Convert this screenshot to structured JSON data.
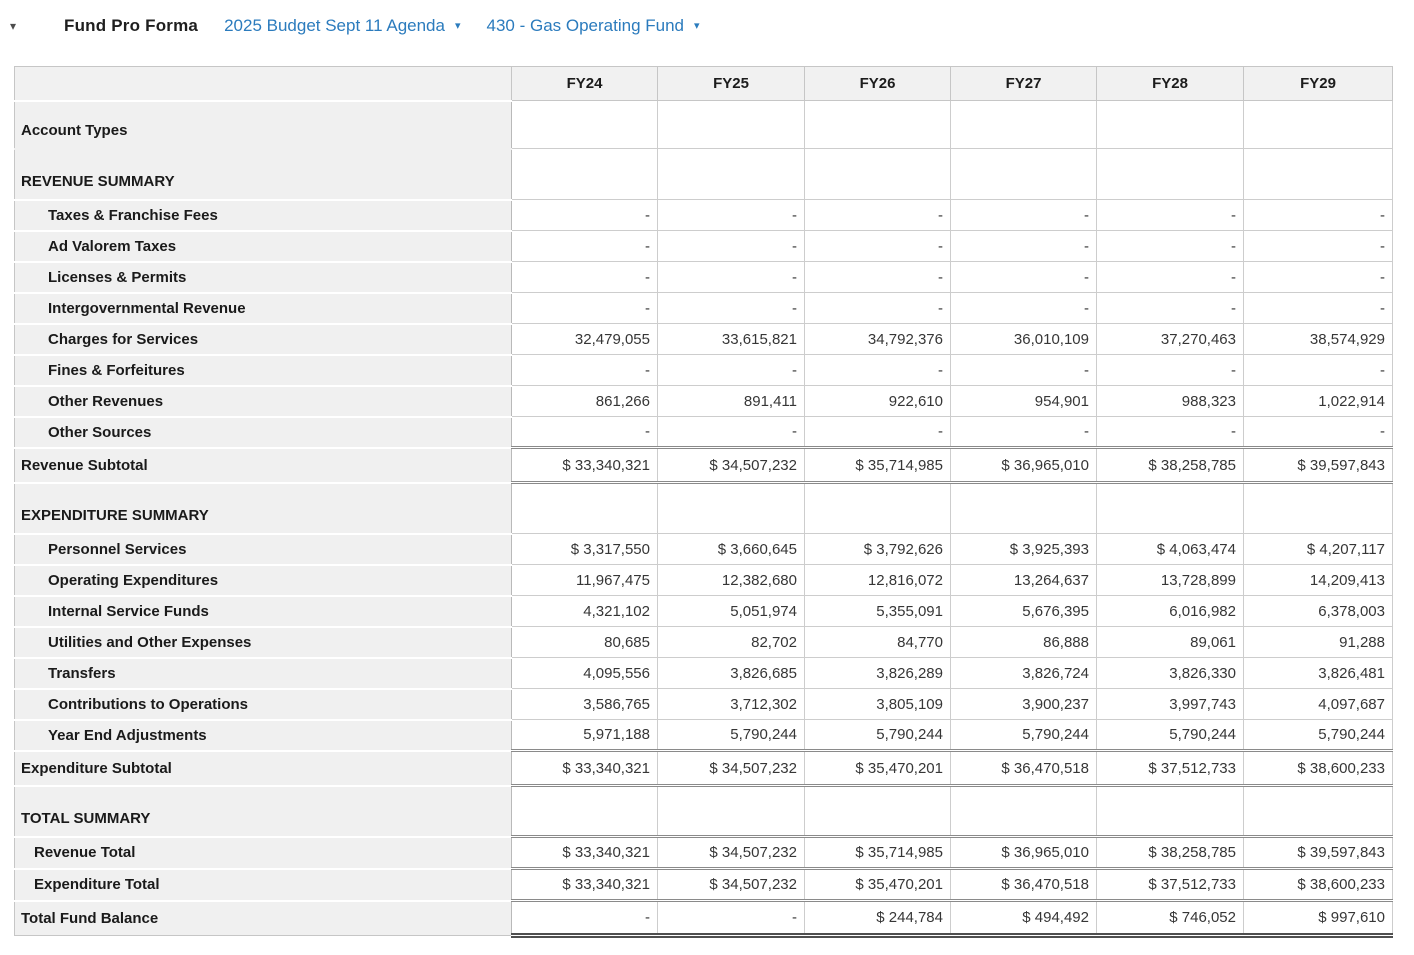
{
  "header": {
    "collapse_caret": "▾",
    "title": "Fund Pro Forma",
    "dropdowns": [
      {
        "label": "2025 Budget Sept 11 Agenda",
        "caret": "▾"
      },
      {
        "label": "430 - Gas Operating Fund",
        "caret": "▾"
      }
    ]
  },
  "colors": {
    "link_blue": "#2b7bbd",
    "label_column_bg": "#f0f0f0",
    "grid_border": "#cdcdcd"
  },
  "table": {
    "columns": [
      "FY24",
      "FY25",
      "FY26",
      "FY27",
      "FY28",
      "FY29"
    ],
    "rows": [
      {
        "label": "Account Types",
        "style": "section-intro",
        "values": [
          "",
          "",
          "",
          "",
          "",
          ""
        ]
      },
      {
        "label": "REVENUE SUMMARY",
        "style": "section",
        "values": [
          "",
          "",
          "",
          "",
          "",
          ""
        ]
      },
      {
        "label": "Taxes & Franchise Fees",
        "style": "detail",
        "values": [
          "-",
          "-",
          "-",
          "-",
          "-",
          "-"
        ]
      },
      {
        "label": "Ad Valorem Taxes",
        "style": "detail",
        "values": [
          "-",
          "-",
          "-",
          "-",
          "-",
          "-"
        ]
      },
      {
        "label": "Licenses & Permits",
        "style": "detail",
        "values": [
          "-",
          "-",
          "-",
          "-",
          "-",
          "-"
        ]
      },
      {
        "label": "Intergovernmental Revenue",
        "style": "detail",
        "values": [
          "-",
          "-",
          "-",
          "-",
          "-",
          "-"
        ]
      },
      {
        "label": "Charges for Services",
        "style": "detail",
        "values": [
          "32,479,055",
          "33,615,821",
          "34,792,376",
          "36,010,109",
          "37,270,463",
          "38,574,929"
        ]
      },
      {
        "label": "Fines & Forfeitures",
        "style": "detail",
        "values": [
          "-",
          "-",
          "-",
          "-",
          "-",
          "-"
        ]
      },
      {
        "label": "Other Revenues",
        "style": "detail",
        "values": [
          "861,266",
          "891,411",
          "922,610",
          "954,901",
          "988,323",
          "1,022,914"
        ]
      },
      {
        "label": "Other Sources",
        "style": "detail",
        "values": [
          "-",
          "-",
          "-",
          "-",
          "-",
          "-"
        ]
      },
      {
        "label": "Revenue Subtotal",
        "style": "subtotal",
        "values": [
          "$ 33,340,321",
          "$ 34,507,232",
          "$ 35,714,985",
          "$ 36,965,010",
          "$ 38,258,785",
          "$ 39,597,843"
        ]
      },
      {
        "label": "EXPENDITURE SUMMARY",
        "style": "section",
        "values": [
          "",
          "",
          "",
          "",
          "",
          ""
        ]
      },
      {
        "label": "Personnel Services",
        "style": "detail",
        "values": [
          "$ 3,317,550",
          "$ 3,660,645",
          "$ 3,792,626",
          "$ 3,925,393",
          "$ 4,063,474",
          "$ 4,207,117"
        ]
      },
      {
        "label": "Operating Expenditures",
        "style": "detail",
        "values": [
          "11,967,475",
          "12,382,680",
          "12,816,072",
          "13,264,637",
          "13,728,899",
          "14,209,413"
        ]
      },
      {
        "label": "Internal Service Funds",
        "style": "detail",
        "values": [
          "4,321,102",
          "5,051,974",
          "5,355,091",
          "5,676,395",
          "6,016,982",
          "6,378,003"
        ]
      },
      {
        "label": "Utilities and Other Expenses",
        "style": "detail",
        "values": [
          "80,685",
          "82,702",
          "84,770",
          "86,888",
          "89,061",
          "91,288"
        ]
      },
      {
        "label": "Transfers",
        "style": "detail",
        "values": [
          "4,095,556",
          "3,826,685",
          "3,826,289",
          "3,826,724",
          "3,826,330",
          "3,826,481"
        ]
      },
      {
        "label": "Contributions to Operations",
        "style": "detail",
        "values": [
          "3,586,765",
          "3,712,302",
          "3,805,109",
          "3,900,237",
          "3,997,743",
          "4,097,687"
        ]
      },
      {
        "label": "Year End Adjustments",
        "style": "detail",
        "values": [
          "5,971,188",
          "5,790,244",
          "5,790,244",
          "5,790,244",
          "5,790,244",
          "5,790,244"
        ]
      },
      {
        "label": "Expenditure Subtotal",
        "style": "subtotal",
        "values": [
          "$ 33,340,321",
          "$ 34,507,232",
          "$ 35,470,201",
          "$ 36,470,518",
          "$ 37,512,733",
          "$ 38,600,233"
        ]
      },
      {
        "label": "TOTAL SUMMARY",
        "style": "section",
        "values": [
          "",
          "",
          "",
          "",
          "",
          ""
        ]
      },
      {
        "label": "Revenue Total",
        "style": "total",
        "values": [
          "$ 33,340,321",
          "$ 34,507,232",
          "$ 35,714,985",
          "$ 36,965,010",
          "$ 38,258,785",
          "$ 39,597,843"
        ]
      },
      {
        "label": "Expenditure Total",
        "style": "total",
        "values": [
          "$ 33,340,321",
          "$ 34,507,232",
          "$ 35,470,201",
          "$ 36,470,518",
          "$ 37,512,733",
          "$ 38,600,233"
        ]
      },
      {
        "label": "Total Fund Balance",
        "style": "grand",
        "values": [
          "-",
          "-",
          "$ 244,784",
          "$ 494,492",
          "$ 746,052",
          "$ 997,610"
        ]
      }
    ]
  }
}
